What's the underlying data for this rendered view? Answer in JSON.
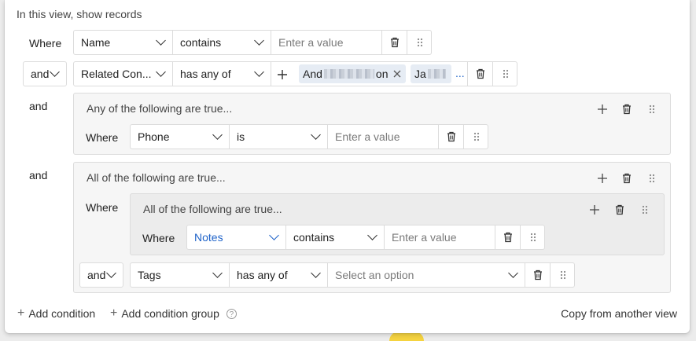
{
  "heading": "In this view, show records",
  "ph_value": "Enter a value",
  "ph_option": "Select an option",
  "row1": {
    "label": "Where",
    "field": "Name",
    "op": "contains"
  },
  "row2": {
    "conj": "and",
    "field": "Related Con...",
    "op": "has any of",
    "chip1_a": "And",
    "chip1_b": "on",
    "chip2_a": "Ja",
    "more": "..."
  },
  "group1": {
    "conj": "and",
    "title": "Any of the following are true...",
    "row": {
      "label": "Where",
      "field": "Phone",
      "op": "is"
    }
  },
  "group2": {
    "conj": "and",
    "title": "All of the following are true...",
    "where": "Where",
    "inner": {
      "title": "All of the following are true...",
      "row": {
        "label": "Where",
        "field": "Notes",
        "op": "contains"
      }
    },
    "row": {
      "conj": "and",
      "field": "Tags",
      "op": "has any of"
    }
  },
  "footer": {
    "add_condition": "Add condition",
    "add_group": "Add condition group",
    "copy": "Copy from another view",
    "help": "?"
  },
  "colors": {
    "accent": "#1f63c9",
    "chip_bg": "#e6ecf4",
    "group_bg": "#f6f6f6",
    "nested_bg": "#ececec"
  }
}
